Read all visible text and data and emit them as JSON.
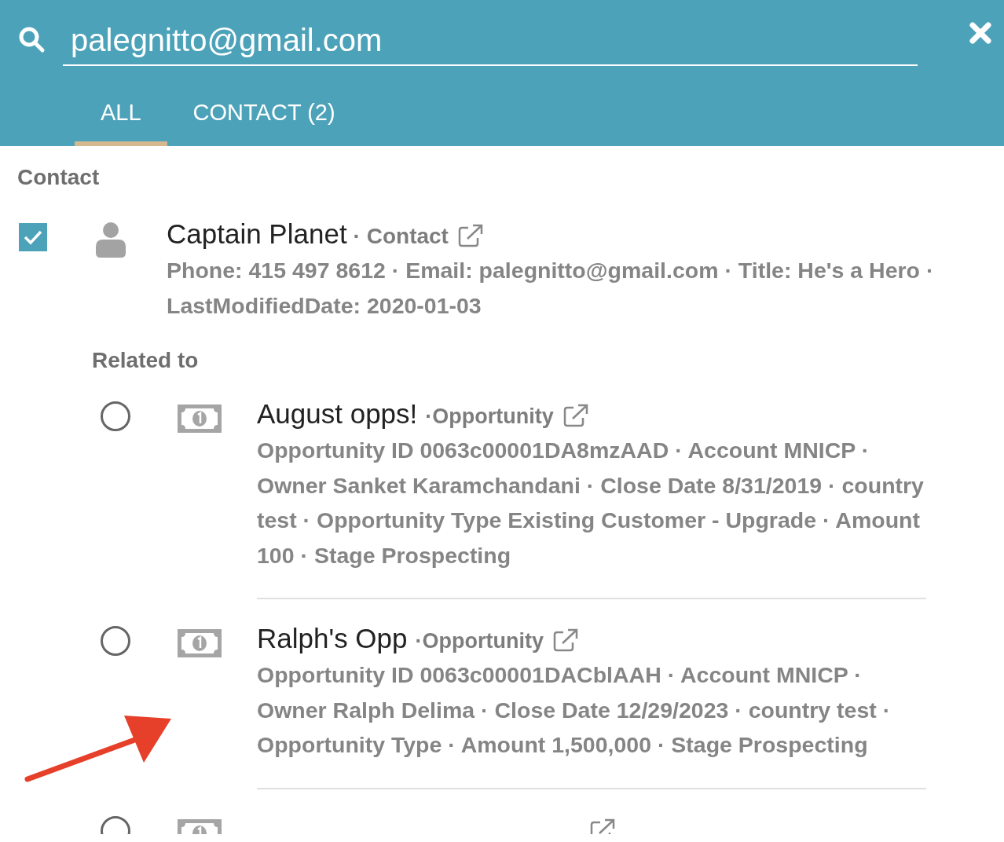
{
  "search": {
    "value": "palegnitto@gmail.com"
  },
  "tabs": [
    {
      "label": "ALL",
      "selected": true
    },
    {
      "label": "CONTACT (2)",
      "selected": false
    }
  ],
  "section_title": "Contact",
  "contact": {
    "checked": true,
    "name": "Captain Planet",
    "type": "· Contact",
    "details": "Phone: 415 497 8612 · Email: palegnitto@gmail.com · Title: He's a Hero · LastModifiedDate: 2020-01-03"
  },
  "related_label": "Related to",
  "related": [
    {
      "selected": false,
      "name": "August opps!",
      "type": "·Opportunity",
      "details": "Opportunity ID 0063c00001DA8mzAAD · Account MNICP · Owner Sanket Karamchandani · Close Date 8/31/2019 · country test · Opportunity Type Existing Customer - Upgrade · Amount 100 · Stage Prospecting"
    },
    {
      "selected": false,
      "name": "Ralph's Opp",
      "type": "·Opportunity",
      "details": "Opportunity ID 0063c00001DACblAAH · Account MNICP · Owner Ralph Delima · Close Date 12/29/2023 · country test · Opportunity Type · Amount 1,500,000 · Stage Prospecting"
    },
    {
      "selected": false
    }
  ]
}
